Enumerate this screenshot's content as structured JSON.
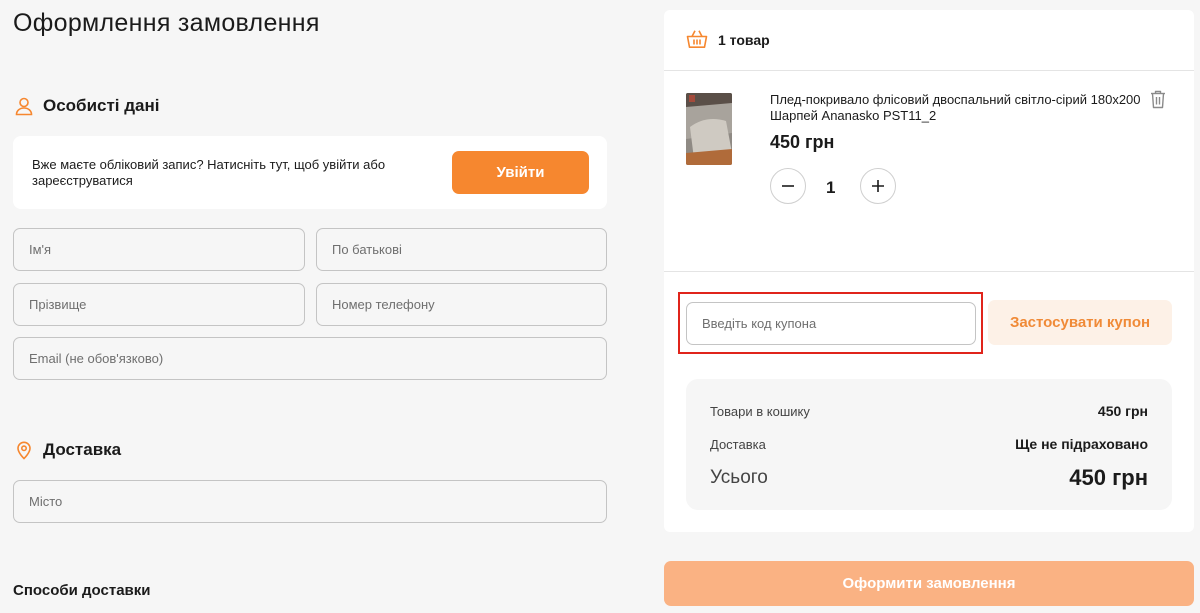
{
  "page": {
    "title": "Оформлення замовлення"
  },
  "personal": {
    "heading": "Особисті дані",
    "login_prompt": "Вже маєте обліковий запис? Натисніть тут, щоб увійти або зареєструватися",
    "login_button": "Увійти",
    "fields": {
      "first_name": "Ім'я",
      "patronymic": "По батькові",
      "last_name": "Прізвище",
      "phone": "Номер телефону",
      "email": "Email (не обов'язково)"
    }
  },
  "delivery": {
    "heading": "Доставка",
    "city_placeholder": "Місто",
    "methods_heading": "Способи доставки"
  },
  "cart": {
    "count_label": "1 товар",
    "item": {
      "name": "Плед-покривало флісовий двоспальний світло-сірий 180x200 Шарпей Ananasko PST11_2",
      "price": "450 грн",
      "quantity": "1"
    },
    "coupon": {
      "placeholder": "Введіть код купона",
      "apply_button": "Застосувати купон"
    },
    "summary": {
      "items_label": "Товари в кошику",
      "items_value": "450 грн",
      "delivery_label": "Доставка",
      "delivery_value": "Ще не підраховано",
      "total_label": "Усього",
      "total_value": "450 грн"
    },
    "submit_button": "Оформити замовлення"
  },
  "colors": {
    "accent": "#f6872f",
    "accent_light": "#fab283",
    "highlight": "#e0241b"
  },
  "icons": {
    "personal": "user-icon",
    "delivery": "location-pin-icon",
    "cart": "basket-icon",
    "remove": "trash-icon",
    "decrease": "minus-icon",
    "increase": "plus-icon"
  }
}
